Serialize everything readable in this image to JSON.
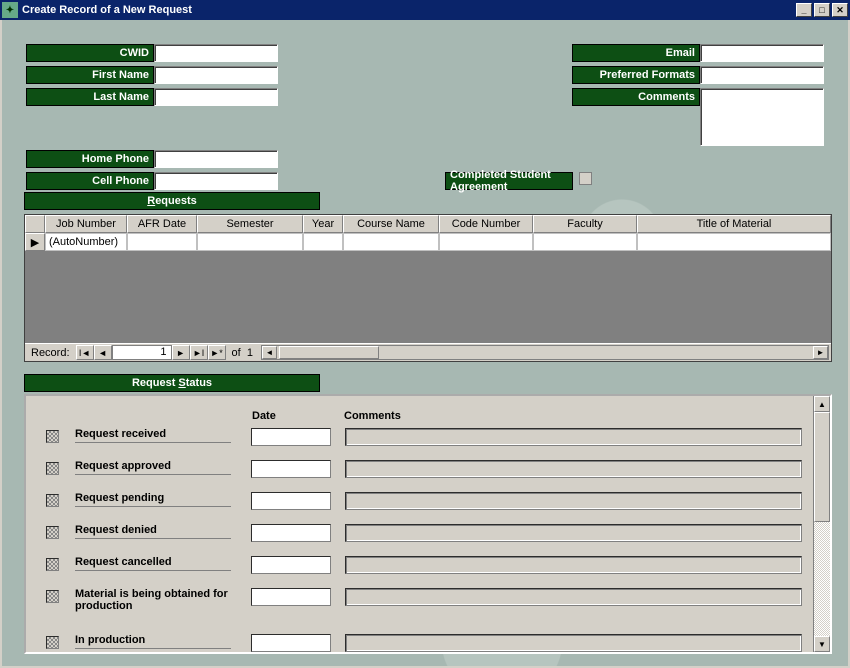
{
  "window": {
    "title": "Create Record of a New Request"
  },
  "form": {
    "cwid_label": "CWID",
    "first_name_label": "First Name",
    "last_name_label": "Last Name",
    "home_phone_label": "Home Phone",
    "cell_phone_label": "Cell Phone",
    "email_label": "Email",
    "pref_formats_label": "Preferred Formats",
    "comments_label": "Comments",
    "agreement_label": "Completed Student Agreement",
    "cwid": "",
    "first_name": "",
    "last_name": "",
    "home_phone": "",
    "cell_phone": "",
    "email": "",
    "pref_formats": "",
    "comments": ""
  },
  "sections": {
    "requests": "Requests",
    "request_status": "Request Status"
  },
  "requests_grid": {
    "columns": {
      "job_number": "Job Number",
      "afr_date": "AFR Date",
      "semester": "Semester",
      "year": "Year",
      "course_name": "Course Name",
      "code_number": "Code Number",
      "faculty": "Faculty",
      "title": "Title of Material"
    },
    "rows": [
      {
        "job_number": "(AutoNumber)",
        "afr_date": "",
        "semester": "",
        "year": "",
        "course_name": "",
        "code_number": "",
        "faculty": "",
        "title": ""
      }
    ],
    "nav": {
      "label": "Record:",
      "current": "1",
      "of_label": "of",
      "total": "1"
    }
  },
  "status": {
    "headers": {
      "date": "Date",
      "comments": "Comments"
    },
    "rows": [
      {
        "label": "Request received"
      },
      {
        "label": "Request approved"
      },
      {
        "label": "Request pending"
      },
      {
        "label": "Request denied"
      },
      {
        "label": "Request cancelled"
      },
      {
        "label": "Material is being obtained for production"
      },
      {
        "label": "In production"
      }
    ]
  }
}
